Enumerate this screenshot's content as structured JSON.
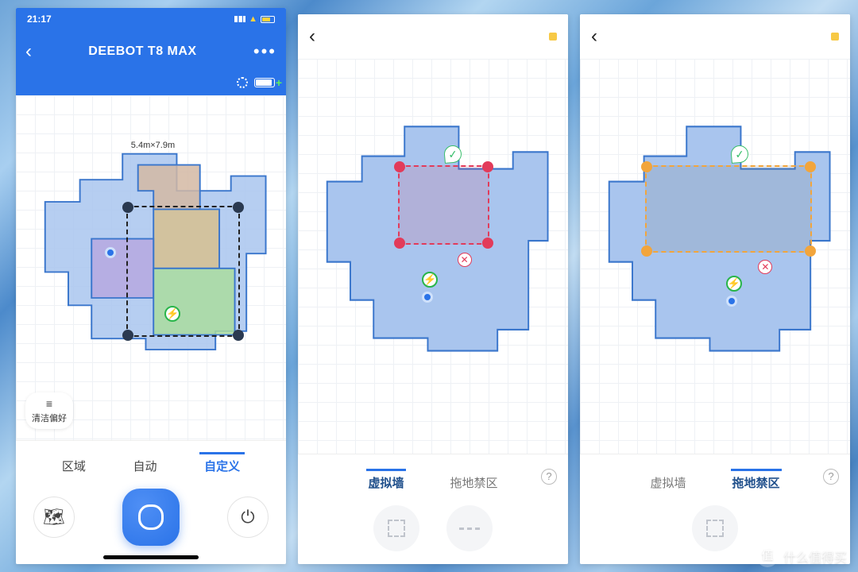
{
  "status": {
    "time": "21:17"
  },
  "nav": {
    "title": "DEEBOT T8 MAX"
  },
  "map": {
    "size_label": "5.4m×7.9m"
  },
  "pref": {
    "label": "清洁偏好"
  },
  "tabs": {
    "area": "区域",
    "auto": "自动",
    "custom": "自定义"
  },
  "seg": {
    "vwall": "虚拟墙",
    "nomop": "拖地禁区",
    "help": "?"
  },
  "watermark": {
    "badge": "值",
    "text": "什么值得买"
  },
  "icons": {
    "check": "✓",
    "x": "✕",
    "bolt": "⚡",
    "map": "🗺",
    "plug": "⏻",
    "sliders": "≡"
  }
}
